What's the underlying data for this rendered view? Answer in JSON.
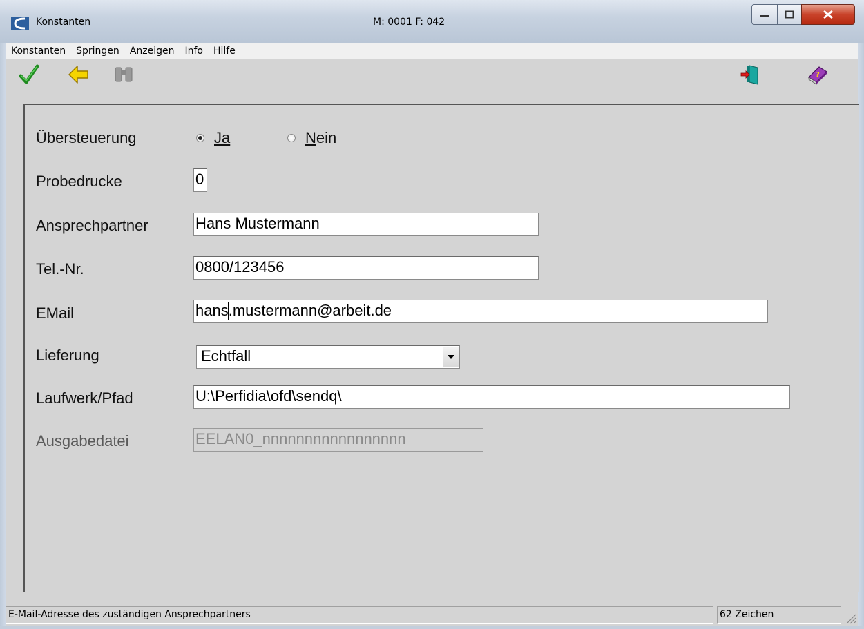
{
  "window": {
    "title": "Konstanten",
    "center_info": "M: 0001 F: 042"
  },
  "menu": [
    "Konstanten",
    "Springen",
    "Anzeigen",
    "Info",
    "Hilfe"
  ],
  "toolbar": {
    "left_icons": [
      "checkmark-icon",
      "back-arrow-icon",
      "binoculars-icon"
    ],
    "right_icons": [
      "exit-door-icon",
      "help-book-icon"
    ]
  },
  "form": {
    "uebersteuerung": {
      "label": "Übersteuerung",
      "options": [
        "Ja",
        "Nein"
      ],
      "selected": "Ja"
    },
    "probedrucke": {
      "label": "Probedrucke",
      "value": "0"
    },
    "ansprechpartner": {
      "label": "Ansprechpartner",
      "value": "Hans Mustermann"
    },
    "telnr": {
      "label": "Tel.-Nr.",
      "value": "0800/123456"
    },
    "email": {
      "label": "EMail",
      "value_before_caret": "hans",
      "value_after_caret": ".mustermann@arbeit.de"
    },
    "lieferung": {
      "label": "Lieferung",
      "value": "Echtfall"
    },
    "pfad": {
      "label": "Laufwerk/Pfad",
      "value": "U:\\Perfidia\\ofd\\sendq\\"
    },
    "ausgabedatei": {
      "label": "Ausgabedatei",
      "value": "EELAN0_nnnnnnnnnnnnnnnnn"
    }
  },
  "status": {
    "message": "E-Mail-Adresse des zuständigen Ansprechpartners",
    "chars": "62 Zeichen"
  },
  "colors": {
    "checkmark": "#1f8a1f",
    "arrow": "#f5d400",
    "close_button": "#c9432a"
  }
}
